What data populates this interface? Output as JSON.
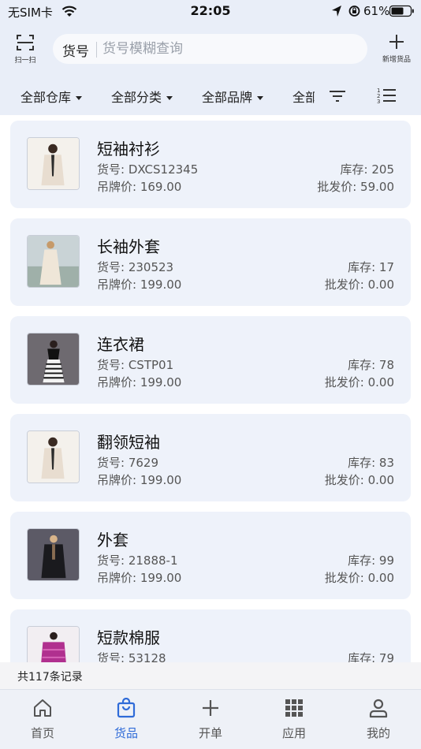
{
  "status_bar": {
    "carrier": "无SIM卡",
    "time": "22:05",
    "battery": "61%"
  },
  "header": {
    "scan_label": "扫一扫",
    "search_key": "货号",
    "search_placeholder": "货号模糊查询",
    "add_label": "新增货品"
  },
  "filters": [
    {
      "label": "全部仓库"
    },
    {
      "label": "全部分类"
    },
    {
      "label": "全部品牌"
    },
    {
      "label": "全部"
    }
  ],
  "products": [
    {
      "name": "短袖衬衫",
      "code": "货号: DXCS12345",
      "tag_price": "吊牌价: 169.00",
      "stock": "库存: 205",
      "wholesale": "批发价: 59.00",
      "image_icon": "beige-coat-photo"
    },
    {
      "name": "长袖外套",
      "code": "货号: 230523",
      "tag_price": "吊牌价: 199.00",
      "stock": "库存: 17",
      "wholesale": "批发价: 0.00",
      "image_icon": "long-coat-photo"
    },
    {
      "name": "连衣裙",
      "code": "货号: CSTP01",
      "tag_price": "吊牌价: 199.00",
      "stock": "库存: 78",
      "wholesale": "批发价: 0.00",
      "image_icon": "striped-dress-photo"
    },
    {
      "name": "翻领短袖",
      "code": "货号: 7629",
      "tag_price": "吊牌价: 199.00",
      "stock": "库存: 83",
      "wholesale": "批发价: 0.00",
      "image_icon": "beige-coat-photo"
    },
    {
      "name": "外套",
      "code": "货号: 21888-1",
      "tag_price": "吊牌价: 199.00",
      "stock": "库存: 99",
      "wholesale": "批发价: 0.00",
      "image_icon": "black-jacket-photo"
    },
    {
      "name": "短款棉服",
      "code": "货号: 53128",
      "tag_price": "",
      "stock": "库存: 79",
      "wholesale": "",
      "image_icon": "purple-padded-jacket-photo"
    }
  ],
  "total": "共117条记录",
  "tabs": [
    {
      "label": "首页",
      "icon": "home-icon",
      "active": false
    },
    {
      "label": "货品",
      "icon": "bag-icon",
      "active": true
    },
    {
      "label": "开单",
      "icon": "plus-icon",
      "active": false
    },
    {
      "label": "应用",
      "icon": "apps-grid-icon",
      "active": false
    },
    {
      "label": "我的",
      "icon": "user-icon",
      "active": false
    }
  ],
  "colors": {
    "accent": "#2f6bd8",
    "background": "#e9eef8",
    "card": "#eef2fa"
  }
}
